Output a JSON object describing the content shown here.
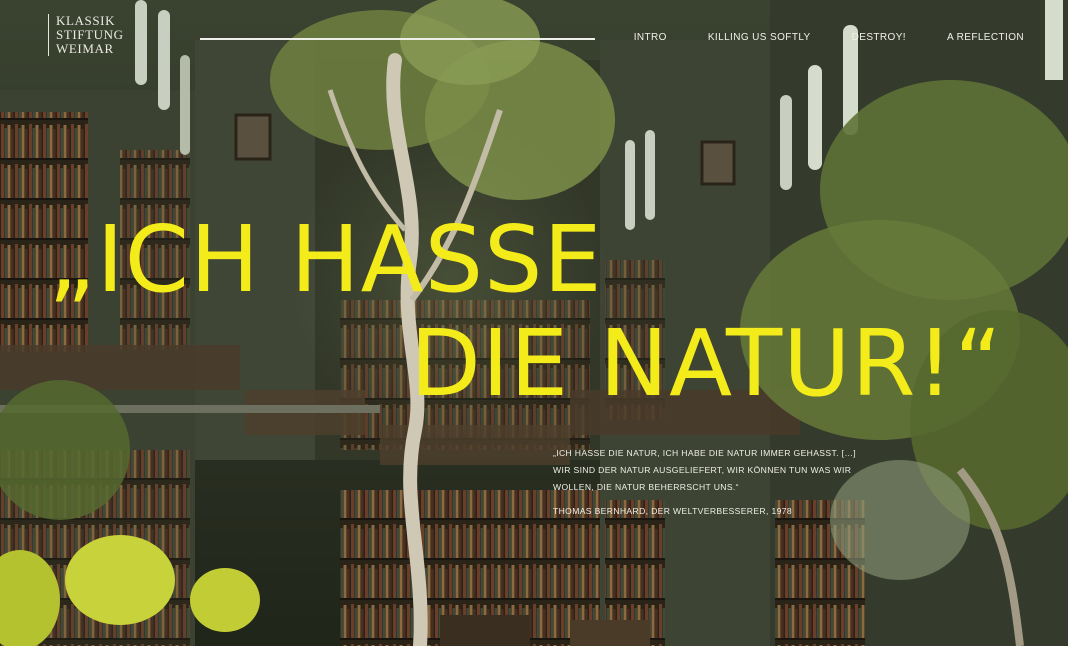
{
  "brand": {
    "line1": "KLASSIK",
    "line2": "STIFTUNG",
    "line3": "WEIMAR"
  },
  "nav": {
    "items": [
      "INTRO",
      "KILLING US SOFTLY",
      "DESTROY!",
      "A REFLECTION"
    ]
  },
  "hero": {
    "headline_line1": "„ICH HASSE",
    "headline_line2": "DIE NATUR!“",
    "quote_text": "„ICH HASSE DIE NATUR, ICH HABE DIE NATUR IMMER GEHASST. […] WIR SIND DER NATUR AUSGELIEFERT, WIR KÖNNEN TUN WAS WIR WOLLEN, DIE NATUR BEHERRSCHT UNS.“",
    "quote_source": "THOMAS BERNHARD, DER WELTVERBESSERER, 1978"
  },
  "colors": {
    "headline": "#f3ec1a",
    "text": "#f0efe6"
  }
}
